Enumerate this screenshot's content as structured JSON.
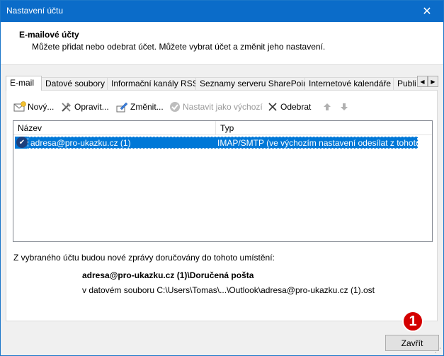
{
  "window": {
    "title": "Nastavení účtu",
    "close_glyph": "✕"
  },
  "header": {
    "title": "E-mailové účty",
    "subtitle": "Můžete přidat nebo odebrat účet. Můžete vybrat účet a změnit jeho nastavení."
  },
  "tabs": [
    {
      "label": "E-mail",
      "active": true
    },
    {
      "label": "Datové soubory",
      "active": false
    },
    {
      "label": "Informační kanály RSS",
      "active": false
    },
    {
      "label": "Seznamy serveru SharePoint",
      "active": false
    },
    {
      "label": "Internetové kalendáře",
      "active": false
    },
    {
      "label": "Publi",
      "active": false
    }
  ],
  "toolbar": {
    "new_label": "Nový...",
    "repair_label": "Opravit...",
    "change_label": "Změnit...",
    "set_default_label": "Nastavit jako výchozí",
    "remove_label": "Odebrat"
  },
  "list": {
    "columns": [
      "Název",
      "Typ"
    ],
    "rows": [
      {
        "name": "adresa@pro-ukazku.cz (1)",
        "type": "IMAP/SMTP (ve výchozím nastavení odesílat z tohoto účtu)"
      }
    ]
  },
  "delivery": {
    "label": "Z vybraného účtu budou nové zprávy doručovány do tohoto umístění:",
    "folder": "adresa@pro-ukazku.cz (1)\\Doručená pošta",
    "file": "v datovém souboru C:\\Users\\Tomas\\...\\Outlook\\adresa@pro-ukazku.cz (1).ost"
  },
  "badge": {
    "number": "1"
  },
  "footer": {
    "close_label": "Zavřít"
  },
  "colors": {
    "accent": "#0078d7",
    "titlebar": "#0b6cc9",
    "badge": "#d40000"
  }
}
